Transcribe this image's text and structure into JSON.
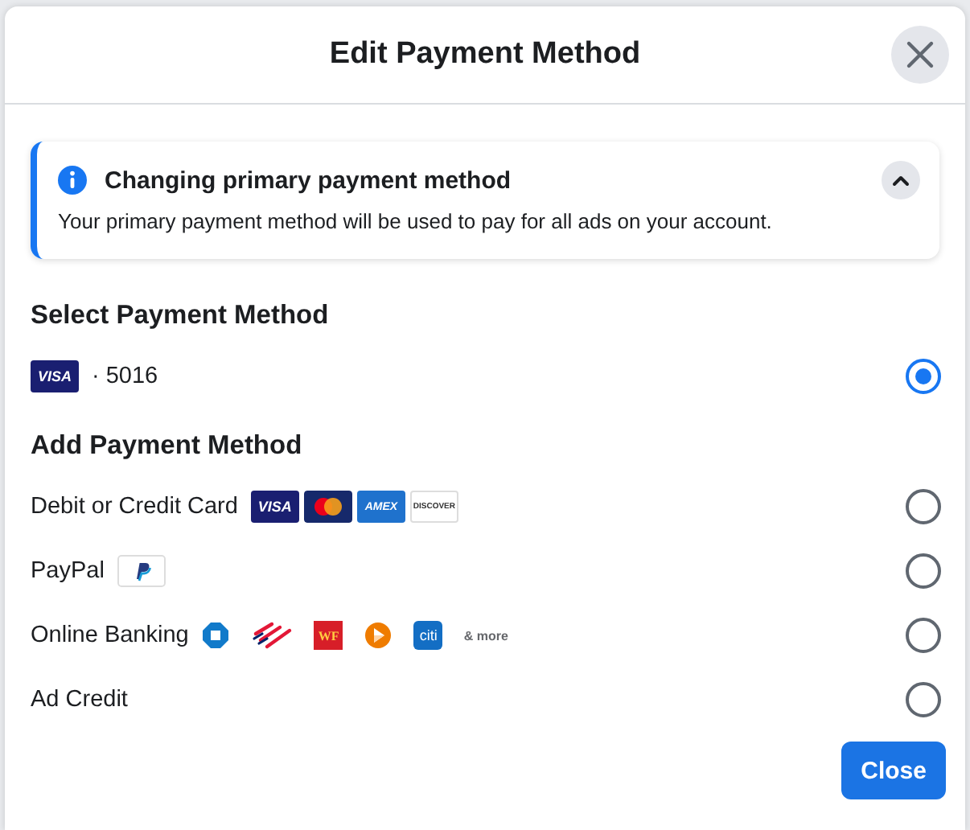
{
  "dialog": {
    "title": "Edit Payment Method"
  },
  "notice": {
    "title": "Changing primary payment method",
    "body": "Your primary payment method will be used to pay for all ads on your account.",
    "expanded": true
  },
  "sections": [
    {
      "heading": "Select Payment Method",
      "options": [
        {
          "kind": "saved",
          "label": "· 5016",
          "selected": true,
          "logos": [
            {
              "kind": "visa",
              "text": "VISA"
            }
          ]
        }
      ]
    },
    {
      "heading": "Add Payment Method",
      "options": [
        {
          "kind": "new",
          "label": "Debit or Credit Card",
          "selected": false,
          "logos": [
            {
              "kind": "visa",
              "text": "VISA"
            },
            {
              "kind": "mastercard"
            },
            {
              "kind": "amex",
              "text": "AMEX"
            },
            {
              "kind": "discover",
              "text": "DISCOVER"
            }
          ]
        },
        {
          "kind": "new",
          "label": "PayPal",
          "selected": false,
          "logos": [
            {
              "kind": "paypal"
            }
          ]
        },
        {
          "kind": "new",
          "label": "Online Banking",
          "selected": false,
          "logos": [
            {
              "kind": "octagon"
            },
            {
              "kind": "flag"
            },
            {
              "kind": "wf",
              "text": "WF"
            },
            {
              "kind": "triangle"
            },
            {
              "kind": "citi",
              "text": "citi"
            },
            {
              "kind": "more",
              "text": "& more"
            }
          ]
        },
        {
          "kind": "new",
          "label": "Ad Credit",
          "selected": false
        }
      ]
    }
  ],
  "buttons": [
    {
      "label": "Close"
    }
  ]
}
